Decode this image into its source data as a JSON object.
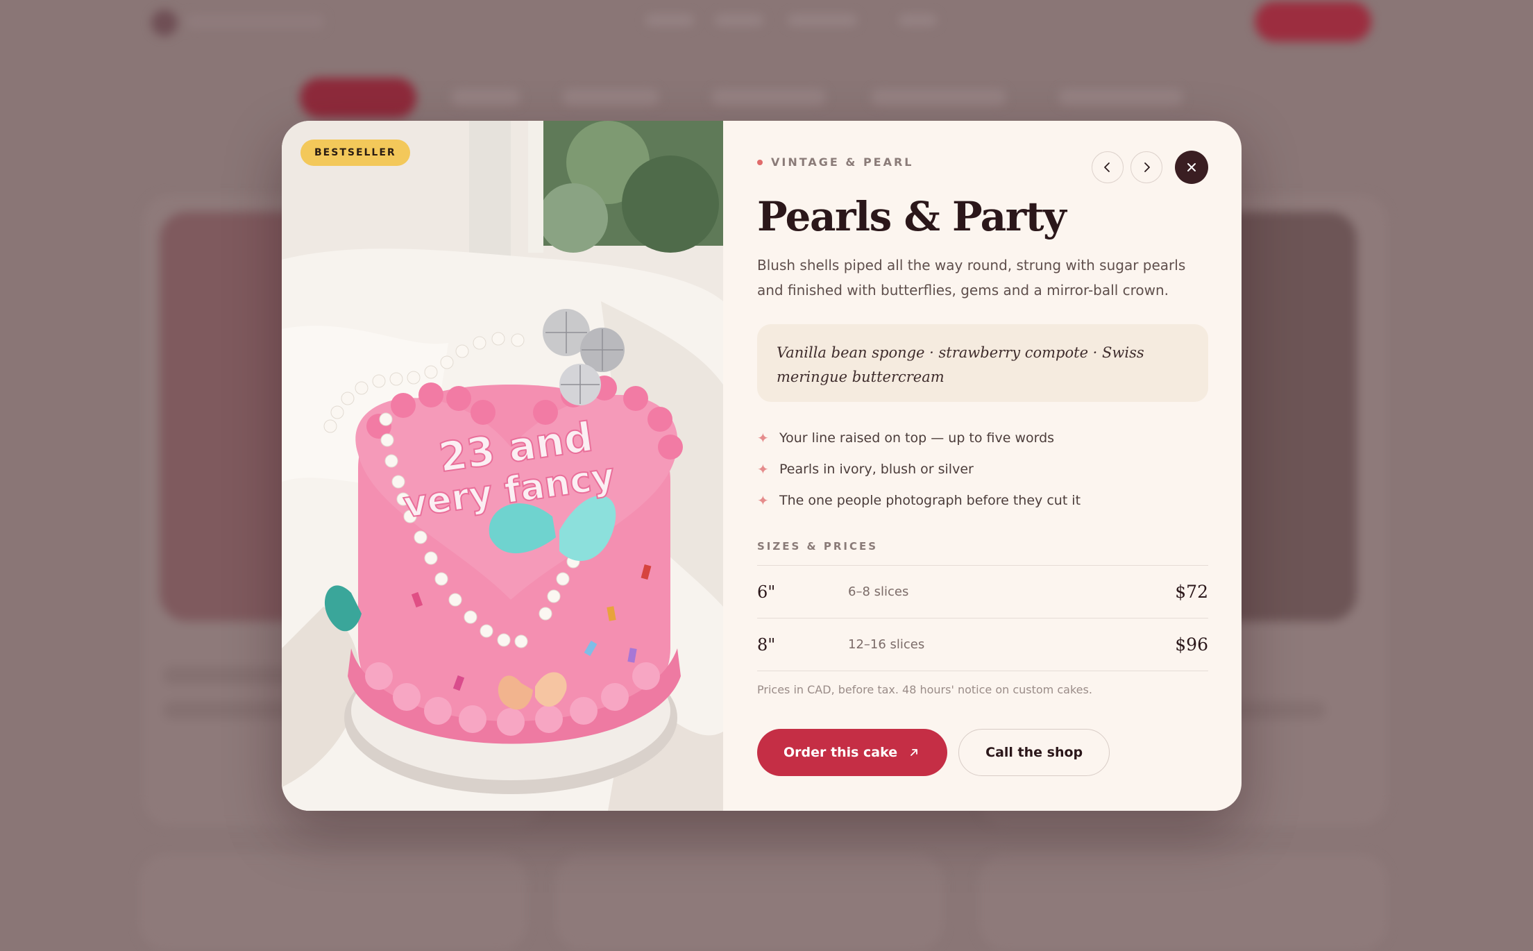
{
  "modal": {
    "badge": "BESTSELLER",
    "eyebrow": "VINTAGE & PEARL",
    "title": "Pearls & Party",
    "description": "Blush shells piped all the way round, strung with sugar pearls and finished with butterflies, gems and a mirror-ball crown.",
    "flavor": "Vanilla bean sponge · strawberry compote · Swiss meringue buttercream",
    "features": [
      "Your line raised on top — up to five words",
      "Pearls in ivory, blush or silver",
      "The one people photograph before they cut it"
    ],
    "sizes_label": "SIZES & PRICES",
    "sizes": [
      {
        "size": "6\"",
        "slices": "6–8 slices",
        "price": "$72"
      },
      {
        "size": "8\"",
        "slices": "12–16 slices",
        "price": "$96"
      }
    ],
    "note": "Prices in CAD, before tax. 48 hours' notice on custom cakes.",
    "order_label": "Order this cake",
    "call_label": "Call the shop",
    "cake_text_line1": "23 and",
    "cake_text_line2": "very fancy"
  },
  "icons": {
    "prev": "chevron-left-icon",
    "next": "chevron-right-icon",
    "close": "close-icon",
    "feature": "sparkle-icon",
    "order": "arrow-up-right-icon"
  },
  "colors": {
    "accent": "#c52e45",
    "badge": "#f3c85a",
    "panel": "#fcf5ef",
    "dark": "#3a1e22"
  }
}
